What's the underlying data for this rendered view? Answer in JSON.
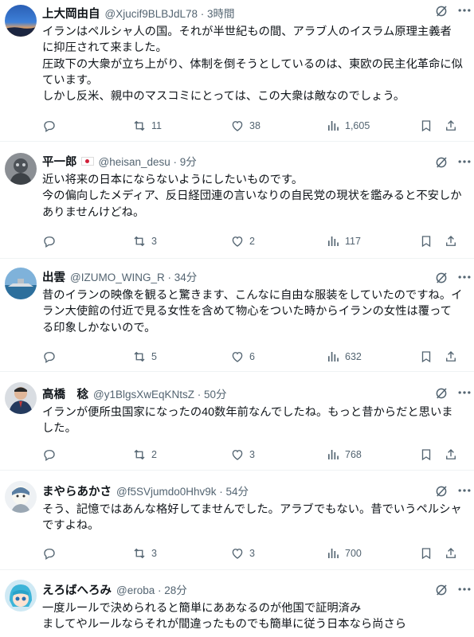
{
  "tweets": [
    {
      "name": "上大岡由自",
      "handle": "@Xjucif9BLBJdL78 · 3時間",
      "text": "イランはペルシャ人の国。それが半世紀もの間、アラブ人のイスラム原理主義者に抑圧されて来ました。\n圧政下の大衆が立ち上がり、体制を倒そうとしているのは、東欧の民主化革命に似ています。\nしかし反米、親中のマスコミにとっては、この大衆は敵なのでしょう。",
      "replies": "",
      "retweets": "11",
      "likes": "38",
      "views": "1,605"
    },
    {
      "name": "平一郎",
      "handle": "@heisan_desu · 9分",
      "text": "近い将来の日本にならないようにしたいものです。\n今の偏向したメディア、反日経団連の言いなりの自民党の現状を鑑みると不安しかありませんけどね。",
      "replies": "",
      "retweets": "3",
      "likes": "2",
      "views": "117"
    },
    {
      "name": "出雲",
      "handle": "@IZUMO_WING_R · 34分",
      "text": "昔のイランの映像を観ると驚きます、こんなに自由な服装をしていたのですね。イラン大使館の付近で見る女性を含めて物心をついた時からイランの女性は覆ってる印象しかないので。",
      "replies": "",
      "retweets": "5",
      "likes": "6",
      "views": "632"
    },
    {
      "name": "高橋　稔",
      "handle": "@y1BlgsXwEqKNtsZ · 50分",
      "text": "イランが便所虫国家になったの40数年前なんでしたね。もっと昔からだと思いました。",
      "replies": "",
      "retweets": "2",
      "likes": "3",
      "views": "768"
    },
    {
      "name": "まやらあかさ",
      "handle": "@f5SVjumdo0Hhv9k · 54分",
      "text": "そう、記憶ではあんな格好してませんでした。アラブでもない。昔でいうペルシャですよね。",
      "replies": "",
      "retweets": "3",
      "likes": "3",
      "views": "700"
    },
    {
      "name": "えろばへろみ",
      "handle": "@eroba · 28分",
      "text": "一度ルールで決められると簡単にああなるのが他国で証明済み\nましてやルールならそれが間違ったものでも簡単に従う日本なら尚さら",
      "replies": "",
      "retweets": "",
      "likes": "",
      "views": ""
    }
  ],
  "icons": {
    "reply": "reply-icon",
    "retweet": "retweet-icon",
    "like": "heart-icon",
    "views": "views-icon",
    "bookmark": "bookmark-icon",
    "share": "share-icon",
    "grok": "grok-icon",
    "more": "more-icon"
  },
  "colors": {
    "text": "#0f1419",
    "secondary": "#536471",
    "divider": "#eff3f4",
    "flag_red": "#d1203a"
  }
}
